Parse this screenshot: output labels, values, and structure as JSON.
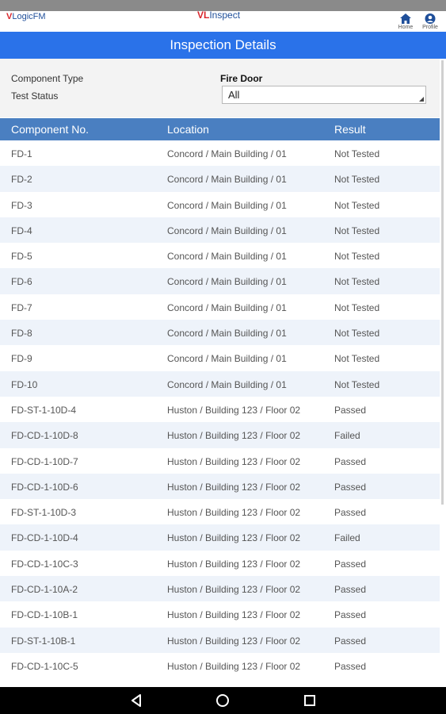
{
  "header": {
    "left_logo_v": "V",
    "left_logo_text": "LogicFM",
    "center_logo_v": "VL",
    "center_logo_text": "Inspect",
    "home_label": "Home",
    "profile_label": "Profile"
  },
  "page_title": "Inspection Details",
  "filters": {
    "component_type_label": "Component Type",
    "component_type_value": "Fire Door",
    "test_status_label": "Test Status",
    "test_status_value": "All"
  },
  "table": {
    "headers": [
      "Component No.",
      "Location",
      "Result"
    ],
    "rows": [
      [
        "FD-1",
        "Concord / Main Building / 01",
        "Not Tested"
      ],
      [
        "FD-2",
        "Concord / Main Building / 01",
        "Not Tested"
      ],
      [
        "FD-3",
        "Concord / Main Building / 01",
        "Not Tested"
      ],
      [
        "FD-4",
        "Concord / Main Building / 01",
        "Not Tested"
      ],
      [
        "FD-5",
        "Concord / Main Building / 01",
        "Not Tested"
      ],
      [
        "FD-6",
        "Concord / Main Building / 01",
        "Not Tested"
      ],
      [
        "FD-7",
        "Concord / Main Building / 01",
        "Not Tested"
      ],
      [
        "FD-8",
        "Concord / Main Building / 01",
        "Not Tested"
      ],
      [
        "FD-9",
        "Concord / Main Building / 01",
        "Not Tested"
      ],
      [
        "FD-10",
        "Concord / Main Building / 01",
        "Not Tested"
      ],
      [
        "FD-ST-1-10D-4",
        "Huston / Building 123 / Floor 02",
        "Passed"
      ],
      [
        "FD-CD-1-10D-8",
        "Huston / Building 123 / Floor 02",
        "Failed"
      ],
      [
        "FD-CD-1-10D-7",
        "Huston / Building 123 / Floor 02",
        "Passed"
      ],
      [
        "FD-CD-1-10D-6",
        "Huston / Building 123 / Floor 02",
        "Passed"
      ],
      [
        "FD-ST-1-10D-3",
        "Huston / Building 123 / Floor 02",
        "Passed"
      ],
      [
        "FD-CD-1-10D-4",
        "Huston / Building 123 / Floor 02",
        "Failed"
      ],
      [
        "FD-CD-1-10C-3",
        "Huston / Building 123 / Floor 02",
        "Passed"
      ],
      [
        "FD-CD-1-10A-2",
        "Huston / Building 123 / Floor 02",
        "Passed"
      ],
      [
        "FD-CD-1-10B-1",
        "Huston / Building 123 / Floor 02",
        "Passed"
      ],
      [
        "FD-ST-1-10B-1",
        "Huston / Building 123 / Floor 02",
        "Passed"
      ],
      [
        "FD-CD-1-10C-5",
        "Huston / Building 123 / Floor 02",
        "Passed"
      ]
    ]
  },
  "colors": {
    "title_bar": "#2a72e9",
    "table_header": "#4a7fc1",
    "row_alt": "#eef3fa",
    "brand_red": "#d9262c",
    "brand_blue": "#1f4f9a"
  },
  "icons": {
    "home": "home-icon",
    "profile": "profile-icon",
    "back": "back-icon",
    "android_home": "android-home-icon",
    "recents": "recents-icon"
  }
}
